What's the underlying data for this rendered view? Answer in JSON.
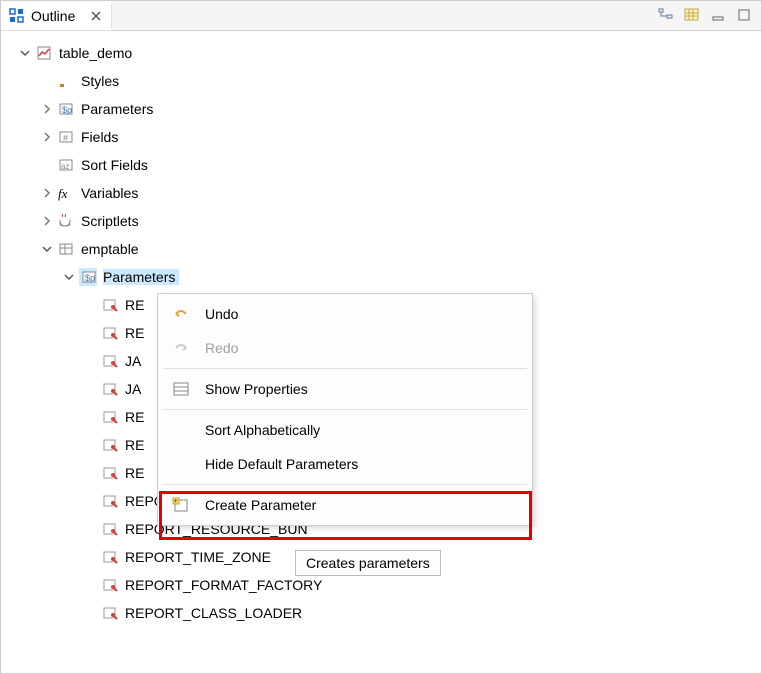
{
  "tab": {
    "title": "Outline"
  },
  "tree": {
    "root": "table_demo",
    "nodes": {
      "styles": "Styles",
      "parameters": "Parameters",
      "fields": "Fields",
      "sortFields": "Sort Fields",
      "variables": "Variables",
      "scriptlets": "Scriptlets",
      "emptable": "emptable",
      "emptableParameters": "Parameters"
    },
    "paramItems": [
      "RE",
      "RE",
      "JA",
      "JA",
      "RE",
      "RE",
      "RE",
      "REPORT_LOCALE",
      "REPORT_RESOURCE_BUN",
      "REPORT_TIME_ZONE",
      "REPORT_FORMAT_FACTORY",
      "REPORT_CLASS_LOADER"
    ]
  },
  "menu": {
    "undo": "Undo",
    "redo": "Redo",
    "showProperties": "Show Properties",
    "sortAlpha": "Sort Alphabetically",
    "hideDefault": "Hide Default Parameters",
    "createParam": "Create Parameter"
  },
  "tooltip": "Creates parameters"
}
